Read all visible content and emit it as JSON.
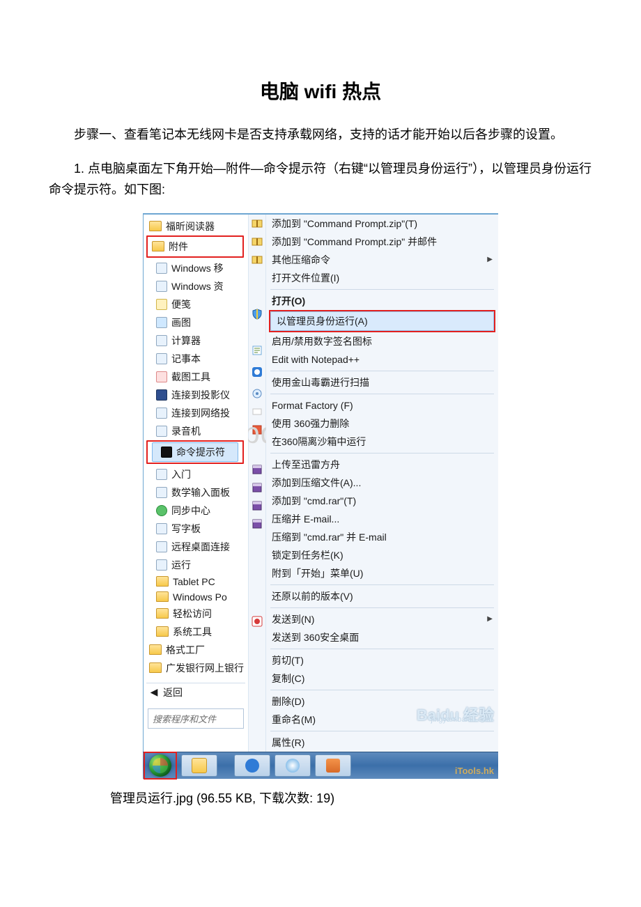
{
  "document": {
    "title": "电脑 wifi 热点",
    "para1": "步骤一、查看笔记本无线网卡是否支持承载网络，支持的话才能开始以后各步骤的设置。",
    "para2": "1. 点电脑桌面左下角开始—附件—命令提示符（右键“以管理员身份运行”），以管理员身份运行命令提示符。如下图:",
    "caption": "管理员运行.jpg (96.55 KB, 下载次数: 19)"
  },
  "watermark": "www.bdocx.com",
  "baidu": {
    "label": "Baidu 经验",
    "url": "jingyan.baidu.com"
  },
  "itools": "iTools.hk",
  "startMenu": {
    "items_top": [
      {
        "label": "福昕阅读器",
        "icon": "folder"
      },
      {
        "label": "附件",
        "icon": "folder",
        "boxed": true
      }
    ],
    "items_sub": [
      "Windows 移",
      "Windows 资",
      "便笺",
      "画图",
      "计算器",
      "记事本",
      "截图工具",
      "连接到投影仪",
      "连接到网络投",
      "录音机"
    ],
    "cmd": "命令提示符",
    "items_after": [
      "入门",
      "数学输入面板",
      "同步中心",
      "写字板",
      "远程桌面连接",
      "运行",
      "Tablet PC",
      "Windows Po",
      "轻松访问",
      "系统工具"
    ],
    "items_bottom": [
      "格式工厂",
      "广发银行网上银行"
    ],
    "back": "返回",
    "search_placeholder": "搜索程序和文件"
  },
  "contextMenu": {
    "g1": [
      {
        "label": "添加到 \"Command Prompt.zip\"(T)",
        "icon": true
      },
      {
        "label": "添加到 \"Command Prompt.zip\" 并邮件",
        "icon": true
      },
      {
        "label": "其他压缩命令",
        "icon": true,
        "arrow": true
      },
      {
        "label": "打开文件位置(I)"
      }
    ],
    "open": "打开(O)",
    "runAdmin": "以管理员身份运行(A)",
    "g2": [
      "启用/禁用数字签名图标",
      "Edit with Notepad++"
    ],
    "g3": [
      "使用金山毒霸进行扫描"
    ],
    "g4": [
      "Format Factory (F)",
      "使用 360强力删除",
      "在360隔离沙箱中运行"
    ],
    "g5": [
      "上传至迅雷方舟",
      "添加到压缩文件(A)...",
      "添加到 \"cmd.rar\"(T)",
      "压缩并 E-mail...",
      "压缩到 \"cmd.rar\" 并 E-mail",
      "锁定到任务栏(K)",
      "附到「开始」菜单(U)"
    ],
    "g6": [
      "还原以前的版本(V)"
    ],
    "g7": [
      {
        "label": "发送到(N)",
        "arrow": true
      },
      {
        "label": "发送到 360安全桌面",
        "icon": true
      }
    ],
    "g8": [
      "剪切(T)",
      "复制(C)"
    ],
    "g9": [
      "删除(D)",
      "重命名(M)"
    ],
    "g10": [
      "属性(R)"
    ]
  }
}
